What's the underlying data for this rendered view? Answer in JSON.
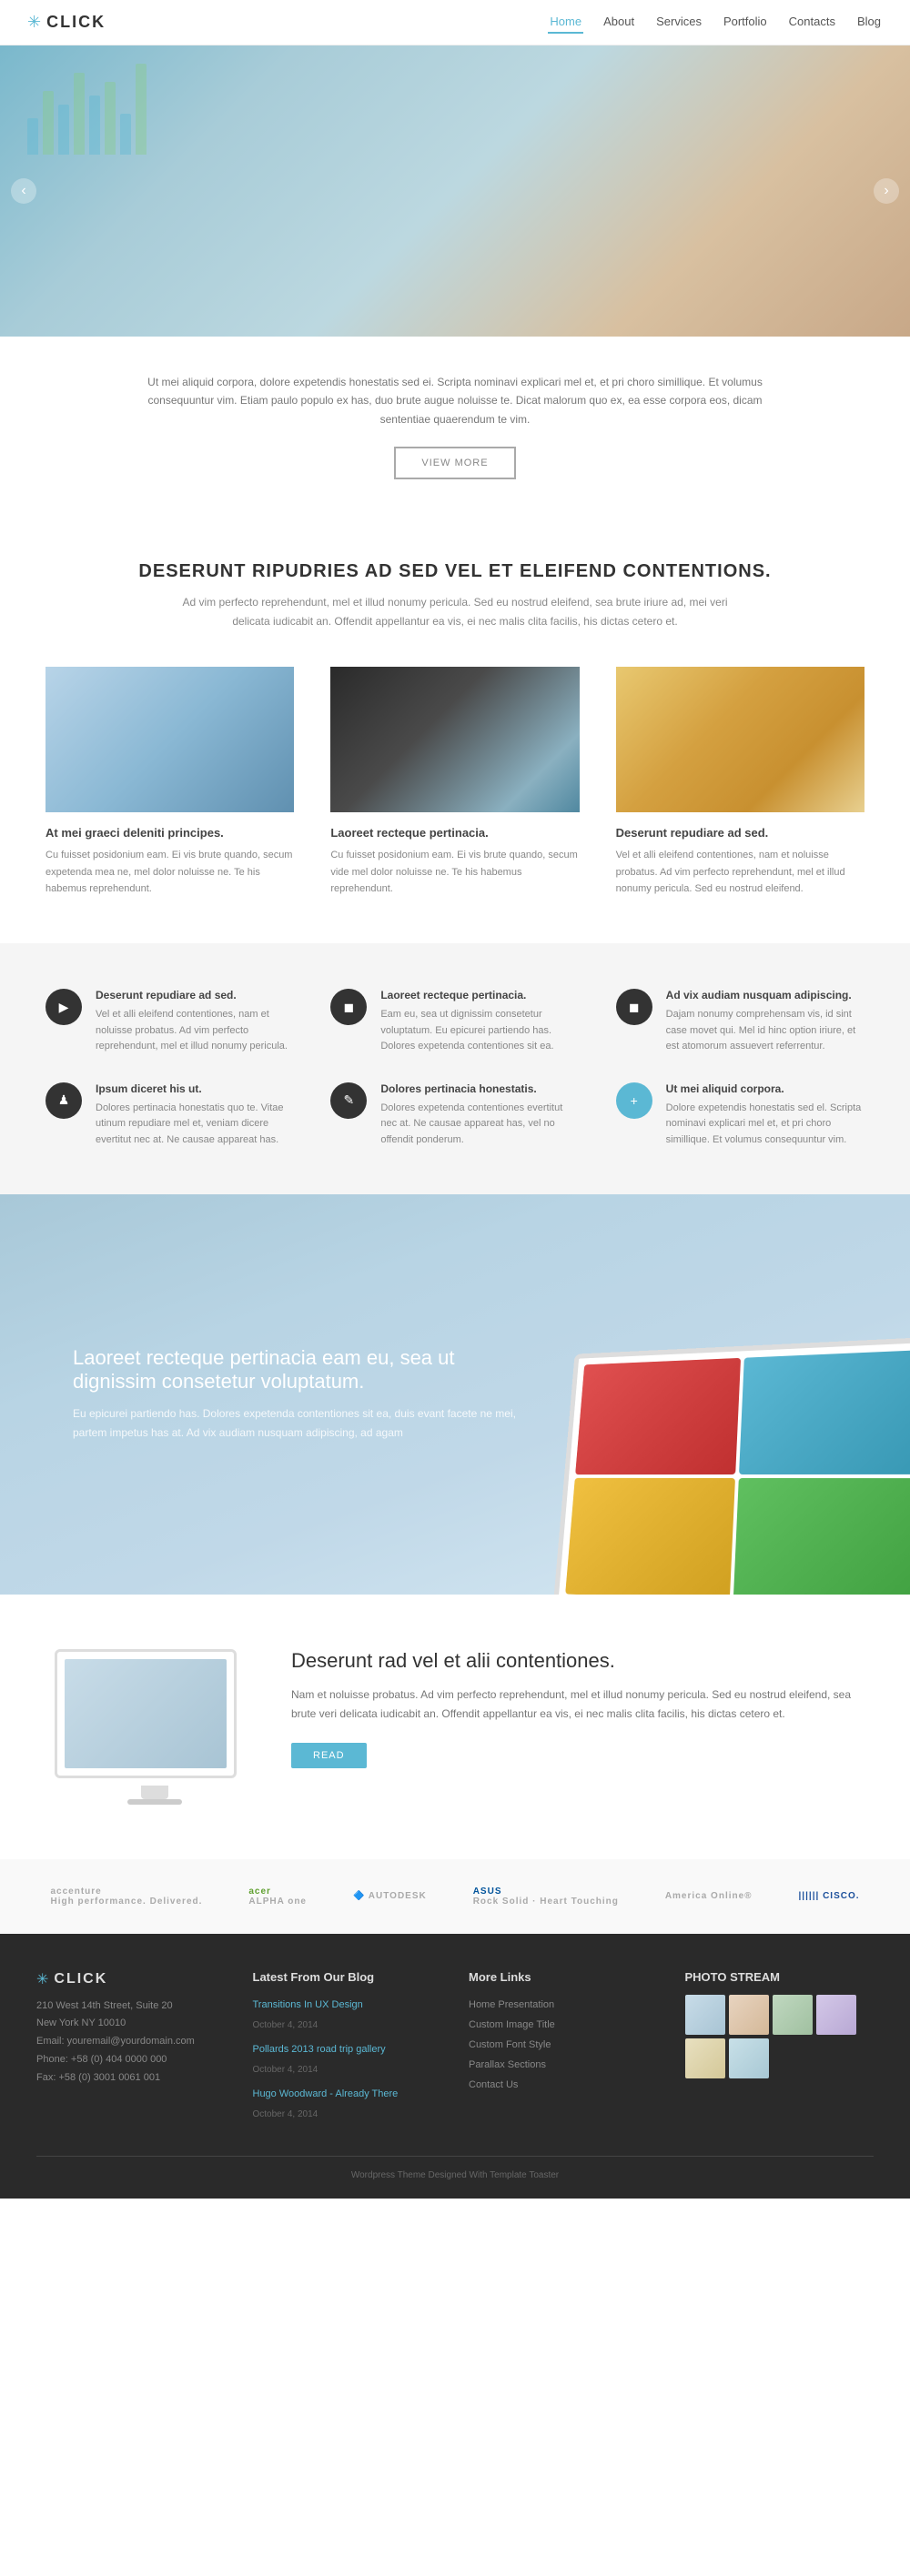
{
  "header": {
    "logo_text": "CLICK",
    "nav_items": [
      {
        "label": "Home",
        "active": true
      },
      {
        "label": "About",
        "active": false
      },
      {
        "label": "Services",
        "active": false
      },
      {
        "label": "Portfolio",
        "active": false
      },
      {
        "label": "Contacts",
        "active": false
      },
      {
        "label": "Blog",
        "active": false
      }
    ]
  },
  "hero": {
    "arrow_left": "‹",
    "arrow_right": "›"
  },
  "intro": {
    "body": "Ut mei aliquid corpora, dolore expetendis honestatis sed ei. Scripta nominavi explicari mel et, et pri choro simillique. Et volumus consequuntur vim. Etiam paulo populo ex has, duo brute augue noluisse te. Dicat malorum quo ex, ea esse corpora eos, dicam sententiae quaerendum te vim.",
    "btn_label": "VIEW MORE"
  },
  "main_heading": {
    "title": "DESERUNT RIPUDRIES AD SED VEL ET ELEIFEND CONTENTIONS.",
    "subtitle": "Ad vim perfecto reprehendunt, mel et illud nonumy pericula. Sed eu nostrud eleifend, sea brute iriure ad, mei veri delicata iudicabit an.\nOffendit appellantur ea vis, ei nec malis clita facilis, his dictas cetero et."
  },
  "columns": [
    {
      "title": "At mei graeci deleniti principes.",
      "body": "Cu fuisset posidonium eam. Ei vis brute quando, secum expetenda mea ne, mel dolor noluisse ne. Te his habemus reprehendunt."
    },
    {
      "title": "Laoreet recteque pertinacia.",
      "body": "Cu fuisset posidonium eam. Ei vis brute quando, secum vide mel dolor noluisse ne. Te his habemus reprehendunt."
    },
    {
      "title": "Deserunt repudiare ad sed.",
      "body": "Vel et alli eleifend contentiones, nam et noluisse probatus. Ad vim perfecto reprehendunt, mel et illud nonumy pericula. Sed eu nostrud eleifend."
    }
  ],
  "features": [
    {
      "icon": "▶",
      "title": "Deserunt repudiare ad sed.",
      "body": "Vel et alli eleifend contentiones, nam et noluisse probatus. Ad vim perfecto reprehendunt, mel et illud nonumy pericula."
    },
    {
      "icon": "◼",
      "title": "Laoreet recteque pertinacia.",
      "body": "Eam eu, sea ut dignissim consetetur voluptatum. Eu epicurei partiendo has. Dolores expetenda contentiones sit ea."
    },
    {
      "icon": "◼",
      "title": "Ad vix audiam nusquam adipiscing.",
      "body": "Dajam nonumy comprehensam vis, id sint case movet qui. Mel id hinc option iriure, et est atomorum assuevert referrentur."
    },
    {
      "icon": "♟",
      "title": "Ipsum diceret his ut.",
      "body": "Dolores pertinacia honestatis quo te. Vitae utinum repudiare mel et, veniam dicere evertitut nec at. Ne causae appareat has."
    },
    {
      "icon": "✎",
      "title": "Dolores pertinacia honestatis.",
      "body": "Dolores expetenda contentiones evertitut nec at. Ne causae appareat has, vel no offendit ponderum."
    },
    {
      "icon": "+",
      "title": "Ut mei aliquid corpora.",
      "body": "Dolore expetendis honestatis sed el. Scripta nominavi explicari mel et, et pri choro simillique. Et volumus consequuntur vim."
    }
  ],
  "parallax": {
    "title": "Laoreet recteque pertinacia eam eu, sea ut dignissim consetetur voluptatum.",
    "body": "Eu epicurei partiendo has. Dolores expetenda contentiones sit ea, duis evant facete ne mei, partem impetus has at. Ad vix audiam nusquam adipiscing, ad agam"
  },
  "read_section": {
    "title": "Deserunt rad vel et alii contentiones.",
    "body": "Nam et noluisse probatus. Ad vim perfecto reprehendunt, mel et illud nonumy pericula. Sed eu nostrud eleifend, sea brute veri delicata iudicabit an. Offendit appellantur ea vis, ei nec malis clita facilis, his dictas cetero et.",
    "btn_label": "READ"
  },
  "logos": [
    {
      "text": "accenture",
      "sub": "High performance. Delivered."
    },
    {
      "text": "acer",
      "sub": "ALPHA one"
    },
    {
      "text": "AUTODESK"
    },
    {
      "text": "ASUS",
      "sub": "Rock Solid · Heart Touching"
    },
    {
      "text": "America Online®"
    },
    {
      "text": "CISCO."
    }
  ],
  "footer": {
    "logo_text": "CLICK",
    "address_col": {
      "title": "CLICK",
      "lines": [
        "210 West 14th Street, Suite 20",
        "New York NY 10010",
        "Email: youremail@yourdomain.com",
        "Phone: +58 (0) 404 0000 000",
        "Fax: +58 (0) 3001 0061 001"
      ]
    },
    "blog_col": {
      "title": "Latest From Our Blog",
      "posts": [
        {
          "title": "Transitions In UX Design",
          "date": "October 4, 2014"
        },
        {
          "title": "Pollards 2013 road trip gallery",
          "date": "October 4, 2014"
        },
        {
          "title": "Hugo Woodward - Already There",
          "date": "October 4, 2014"
        }
      ]
    },
    "links_col": {
      "title": "More Links",
      "links": [
        "Home Presentation",
        "Custom Image Title",
        "Custom Font Style",
        "Parallax Sections",
        "Contact Us"
      ]
    },
    "photo_col": {
      "title": "PHOTO STREAM"
    },
    "bottom_text": "Wordpress Theme Designed With Template Toaster"
  }
}
